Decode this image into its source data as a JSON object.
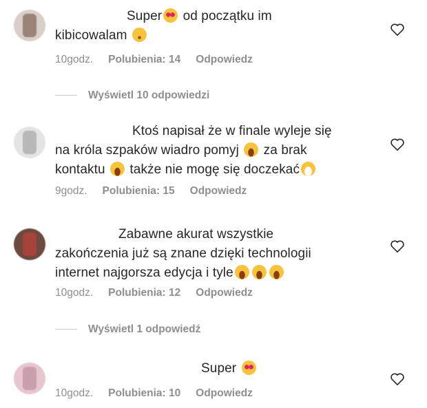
{
  "comments": [
    {
      "lines": [
        {
          "pre": "Super",
          "emoji1": "heart-eyes-emoji",
          "post": " od początku im"
        },
        {
          "pre": "kibicowalam ",
          "emoji1": "wink-emoji",
          "post": ""
        }
      ],
      "time": "10godz.",
      "likes": "Polubienia: 14",
      "reply": "Odpowiedz",
      "view_replies": "Wyświetl 10 odpowiedzi"
    },
    {
      "lines": [
        {
          "text": "Ktoś napisał że w finale wyleje się"
        },
        {
          "pre": "na króla szpaków wiadro pomyj ",
          "emoji1": "laughing-tears-emoji",
          "post": " za brak"
        },
        {
          "pre": "kontaktu ",
          "emoji1": "laughing-tears-emoji",
          "post": " także nie mogę się doczekać",
          "emoji2": "grin-emoji"
        }
      ],
      "time": "9godz.",
      "likes": "Polubienia: 15",
      "reply": "Odpowiedz"
    },
    {
      "lines": [
        {
          "text": "Zabawne akurat wszystkie"
        },
        {
          "text": "zakończenia już są znane dzięki technologii"
        },
        {
          "pre": "internet najgorsza edycja i tyle",
          "emoji1": "laughing-tears-emoji"
        }
      ],
      "time": "10godz.",
      "likes": "Polubienia: 12",
      "reply": "Odpowiedz",
      "view_replies": "Wyświetl 1 odpowiedź"
    },
    {
      "lines": [
        {
          "pre": "Super ",
          "emoji1": "heart-eyes-emoji",
          "post": ""
        }
      ],
      "time": "10godz.",
      "likes": "Polubienia: 10",
      "reply": "Odpowiedz"
    }
  ],
  "colors": {
    "meta_text": "#8e8e8e",
    "body_text": "#262626",
    "emoji_yellow": "#f7c33c"
  }
}
